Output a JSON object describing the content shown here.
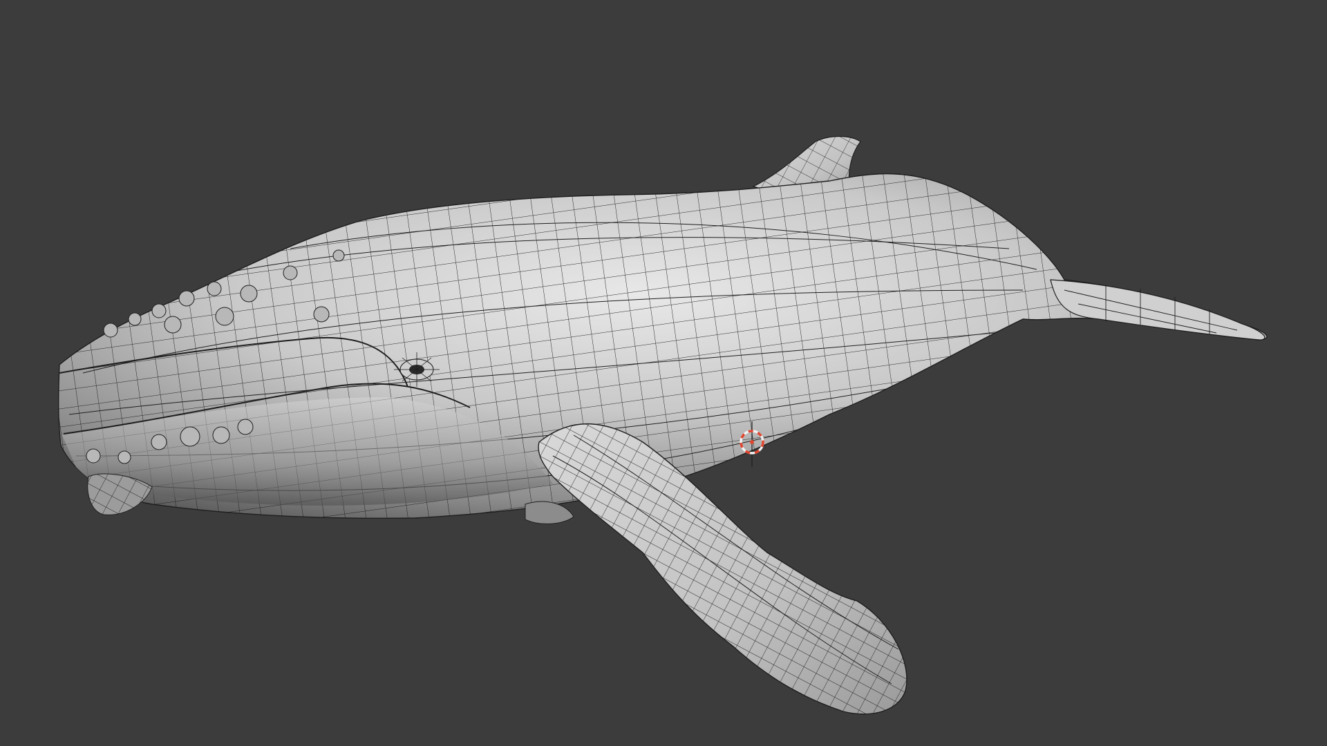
{
  "viewport": {
    "background": "#3c3c3c",
    "mode": "wireframe-overlay"
  },
  "model": {
    "name": "humpback-whale",
    "surface_light": "#e6e6e6",
    "surface_mid": "#b3b3b3",
    "surface_dark": "#5a5a5a",
    "wire_color": "#1e1e1e"
  },
  "cursor3d": {
    "ring_red": "#e0452e",
    "ring_white": "#f2f2f2"
  }
}
